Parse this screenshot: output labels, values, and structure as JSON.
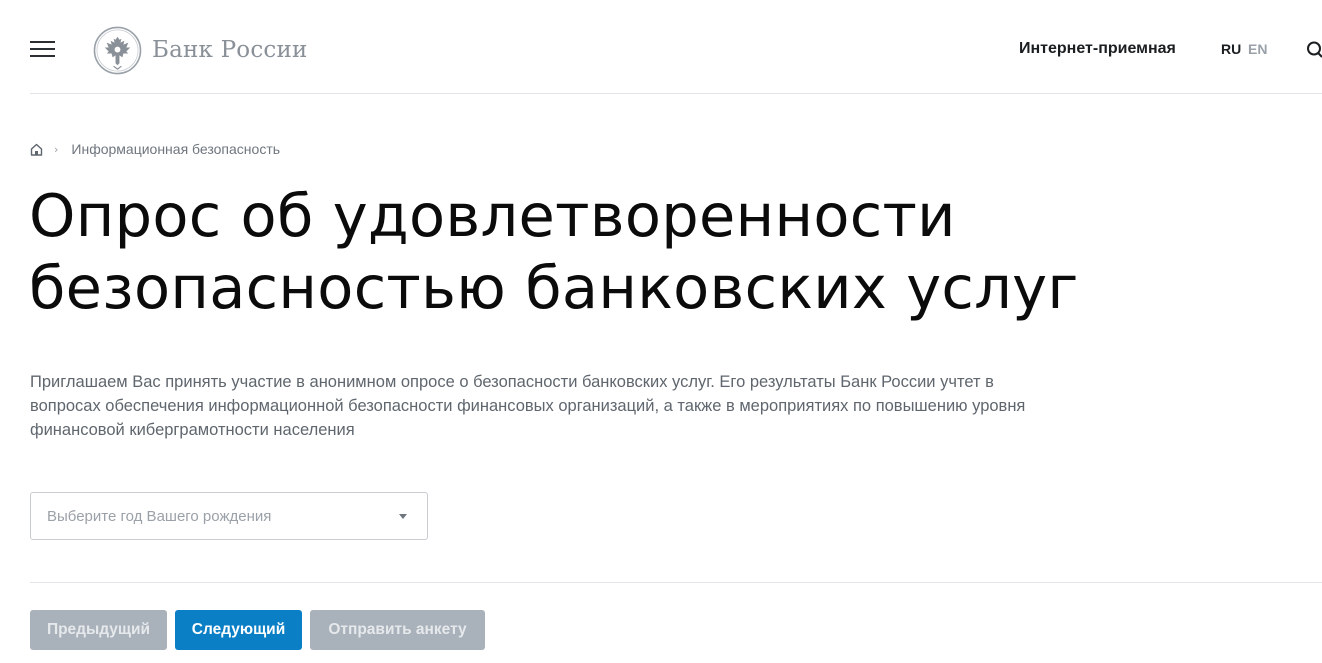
{
  "header": {
    "menu_icon": "hamburger-menu-icon",
    "logo_emblem": "double-headed-eagle-emblem",
    "logo_text": "Банк России",
    "reception_link": "Интернет-приемная",
    "languages": [
      "RU",
      "EN"
    ],
    "active_language": "RU",
    "search_icon": "search-icon"
  },
  "breadcrumb": {
    "home_icon": "home-icon",
    "separator": "›",
    "current": "Информационная безопасность"
  },
  "page": {
    "title_line1": "Опрос об удовлетворенности",
    "title_line2": "безопасностью банковских услуг",
    "intro_line1": "Приглашаем Вас принять участие в анонимном опросе о безопасности банковских услуг. Его результаты Банк России учтет в",
    "intro_line2": "вопросах обеспечения информационной безопасности финансовых организаций, а также в мероприятиях по повышению уровня",
    "intro_line3": "финансовой киберграмотности населения"
  },
  "form": {
    "birth_year_placeholder": "Выберите год Вашего рождения",
    "caret_icon": "caret-down-icon"
  },
  "buttons": {
    "prev_label": "Предыдущий",
    "next_label": "Следующий",
    "submit_label": "Отправить анкету"
  },
  "colors": {
    "primary": "#0a7fc5",
    "disabled": "#a9b1ba",
    "text_muted": "#5f666d"
  }
}
